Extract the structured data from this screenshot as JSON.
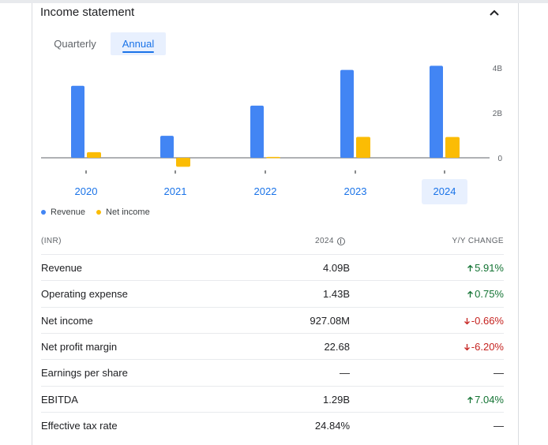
{
  "header": {
    "title": "Income statement"
  },
  "tabs": [
    {
      "label": "Quarterly",
      "active": false
    },
    {
      "label": "Annual",
      "active": true
    }
  ],
  "legend": [
    {
      "label": "Revenue",
      "color": "#4285f4"
    },
    {
      "label": "Net income",
      "color": "#fbbc04"
    }
  ],
  "chart_data": {
    "type": "bar",
    "categories": [
      "2020",
      "2021",
      "2022",
      "2023",
      "2024"
    ],
    "selected_category": "2024",
    "series": [
      {
        "name": "Revenue",
        "color": "#4285f4",
        "values": [
          3.2,
          0.98,
          2.32,
          3.91,
          4.09
        ]
      },
      {
        "name": "Net income",
        "color": "#fbbc04",
        "values": [
          0.25,
          -0.4,
          0.04,
          0.93,
          0.927
        ]
      }
    ],
    "y_ticks": [
      {
        "value": 4,
        "label": "4B"
      },
      {
        "value": 2,
        "label": "2B"
      },
      {
        "value": 0,
        "label": "0"
      }
    ],
    "ylim": [
      -0.5,
      4.2
    ],
    "unit": "B"
  },
  "table": {
    "headers": {
      "currency": "(INR)",
      "year": "2024",
      "change": "Y/Y CHANGE"
    },
    "rows": [
      {
        "label": "Revenue",
        "value": "4.09B",
        "change": "5.91%",
        "dir": "up"
      },
      {
        "label": "Operating expense",
        "value": "1.43B",
        "change": "0.75%",
        "dir": "up"
      },
      {
        "label": "Net income",
        "value": "927.08M",
        "change": "-0.66%",
        "dir": "down"
      },
      {
        "label": "Net profit margin",
        "value": "22.68",
        "change": "-6.20%",
        "dir": "down"
      },
      {
        "label": "Earnings per share",
        "value": "—",
        "change": "—",
        "dir": "none"
      },
      {
        "label": "EBITDA",
        "value": "1.29B",
        "change": "7.04%",
        "dir": "up"
      },
      {
        "label": "Effective tax rate",
        "value": "24.84%",
        "change": "—",
        "dir": "none"
      }
    ]
  }
}
